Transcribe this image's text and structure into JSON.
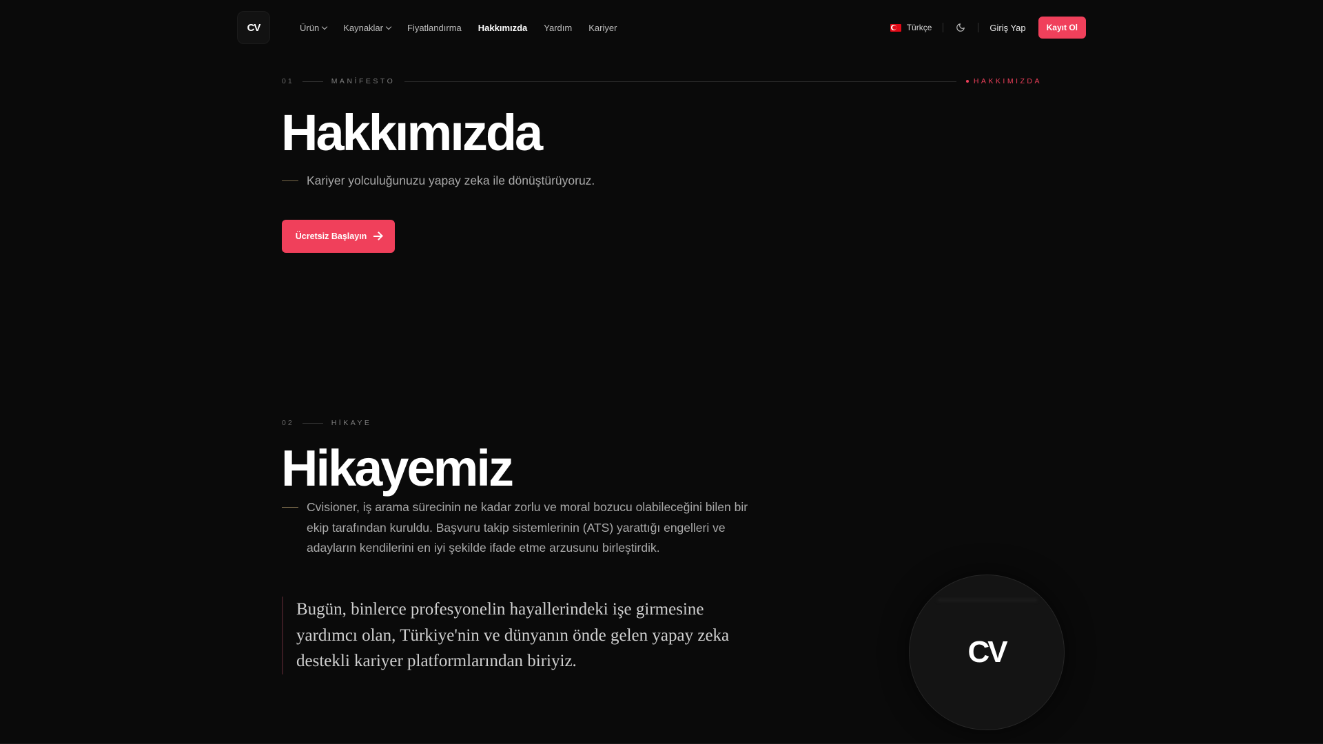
{
  "nav": {
    "logo": "CV",
    "links": [
      {
        "label": "Ürün",
        "dropdown": true
      },
      {
        "label": "Kaynaklar",
        "dropdown": true
      },
      {
        "label": "Fiyatlandırma",
        "dropdown": false
      },
      {
        "label": "Hakkımızda",
        "dropdown": false,
        "active": true
      },
      {
        "label": "Yardım",
        "dropdown": false
      },
      {
        "label": "Kariyer",
        "dropdown": false
      }
    ],
    "language": "Türkçe",
    "language_flag_icon": "turkey-flag-icon",
    "theme_icon": "moon-icon",
    "login": "Giriş Yap",
    "signup": "Kayıt Ol"
  },
  "section1": {
    "num": "01",
    "label": "MANİFESTO",
    "tag": "HAKKIMIZDA",
    "title": "Hakkımızda",
    "lead": "Kariyer yolculuğunuzu yapay zeka ile dönüştürüyoruz.",
    "cta": "Ücretsiz Başlayın"
  },
  "section2": {
    "num": "02",
    "label": "HİKAYE",
    "title": "Hikayemiz",
    "body": "Cvisioner, iş arama sürecinin ne kadar zorlu ve moral bozucu olabileceğini bilen bir ekip tarafından kuruldu. Başvuru takip sistemlerinin (ATS) yarattığı engelleri ve adayların kendilerini en iyi şekilde ifade etme arzusunu birleştirdik.",
    "quote": "Bugün, binlerce profesyonelin hayallerindeki işe girmesine yardımcı olan, Türkiye'nin ve dünyanın önde gelen yapay zeka destekli kariyer platformlarından biriyiz.",
    "badge_logo": "CV"
  },
  "colors": {
    "background": "#0a0a0a",
    "accent": "#f0405b",
    "text": "#ffffff",
    "muted": "#a9a9a9"
  }
}
